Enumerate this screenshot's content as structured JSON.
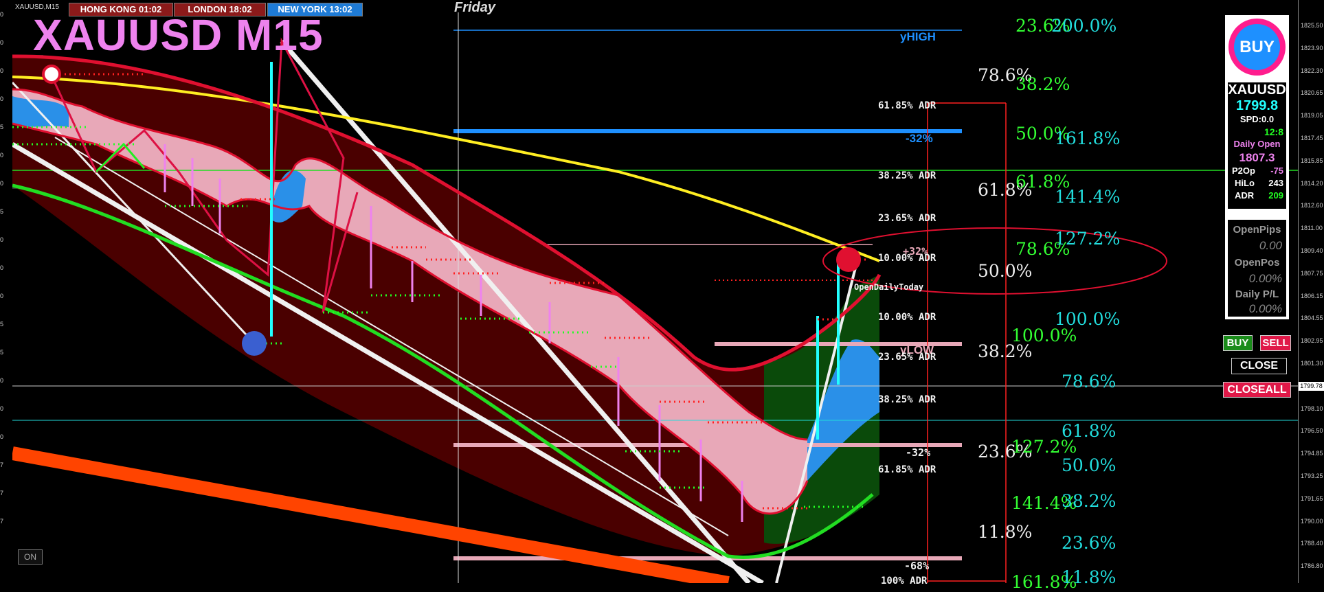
{
  "chart": {
    "symbol_tag": "XAUUSD,M15",
    "title": "XAUUSD M15",
    "day": "Friday",
    "sessions": [
      {
        "label": "HONG KONG 01:02",
        "color": "#8b1a1a"
      },
      {
        "label": "LONDON  18:02",
        "color": "#8b1a1a"
      },
      {
        "label": "NEW YORK  13:02",
        "color": "#1e7bd6"
      }
    ],
    "on_button": "ON",
    "y_high_label": "yHIGH",
    "y_low_label": "yLOW",
    "open_today_label": "OpenDailyToday",
    "pct_labels": [
      "-32%",
      "+32%",
      "-32%",
      "-68%"
    ],
    "adr_levels": [
      "61.85% ADR",
      "38.25% ADR",
      "23.65% ADR",
      "10.00% ADR",
      "10.00% ADR",
      "23.65% ADR",
      "38.25% ADR",
      "61.85% ADR",
      "100% ADR"
    ],
    "fib_white": [
      "78.6%",
      "61.8%",
      "50.0%",
      "38.2%",
      "23.6%",
      "11.8%"
    ],
    "fib_green": [
      "23.6%",
      "38.2%",
      "50.0%",
      "61.8%",
      "78.6%",
      "100.0%",
      "127.2%",
      "141.4%",
      "161.8%"
    ],
    "fib_cyan": [
      "200.0%",
      "161.8%",
      "141.4%",
      "127.2%",
      "100.0%",
      "78.6%",
      "61.8%",
      "50.0%",
      "38.2%",
      "23.6%",
      "11.8%"
    ]
  },
  "price_axis": {
    "ticks": [
      "1825.50",
      "1823.90",
      "1822.30",
      "1820.65",
      "1819.05",
      "1817.45",
      "1815.85",
      "1814.20",
      "1812.60",
      "1811.00",
      "1809.40",
      "1807.75",
      "1806.15",
      "1804.55",
      "1802.95",
      "1801.30",
      "1799.78",
      "1798.10",
      "1796.50",
      "1794.85",
      "1793.25",
      "1791.65",
      "1790.00",
      "1788.40",
      "1786.80"
    ],
    "current_price": "1799.78",
    "left_ticks": [
      "0",
      "0",
      "0",
      "0",
      "5",
      "0",
      "0",
      "5",
      "0",
      "0",
      "0",
      "5",
      "5",
      "0",
      "0",
      "0",
      "7",
      "7",
      "7"
    ]
  },
  "panel": {
    "buy_label": "BUY",
    "symbol": "XAUUSD",
    "price": "1799.8",
    "spread": "SPD:0.0",
    "time": "12:8",
    "daily_open_label": "Daily Open",
    "daily_open_value": "1807.3",
    "p2o_label": "P2Op",
    "p2o_value": "-75",
    "hilo_label": "HiLo",
    "hilo_value": "243",
    "adr_label": "ADR",
    "adr_value": "209",
    "open_pips_label": "OpenPips",
    "open_pips_value": "0.00",
    "open_pos_label": "OpenPos",
    "open_pos_value": "0.00%",
    "daily_pl_label": "Daily P/L",
    "daily_pl_value": "0.00%"
  },
  "buttons": {
    "buy": "BUY",
    "sell": "SELL",
    "close": "CLOSE",
    "closeall": "CLOSEALL"
  },
  "colors": {
    "background": "#000000",
    "band_dark_red": "#4a0000",
    "band_pink": "#e8a8b8",
    "band_green": "#0a4a0a",
    "band_blue": "#2a90e8",
    "ma_red": "#e01030",
    "ma_green": "#22dd22",
    "ma_yellow": "#ffee22",
    "trend_orange": "#ff4400",
    "dots_red": "#ff2020",
    "dots_green": "#22ff22"
  }
}
